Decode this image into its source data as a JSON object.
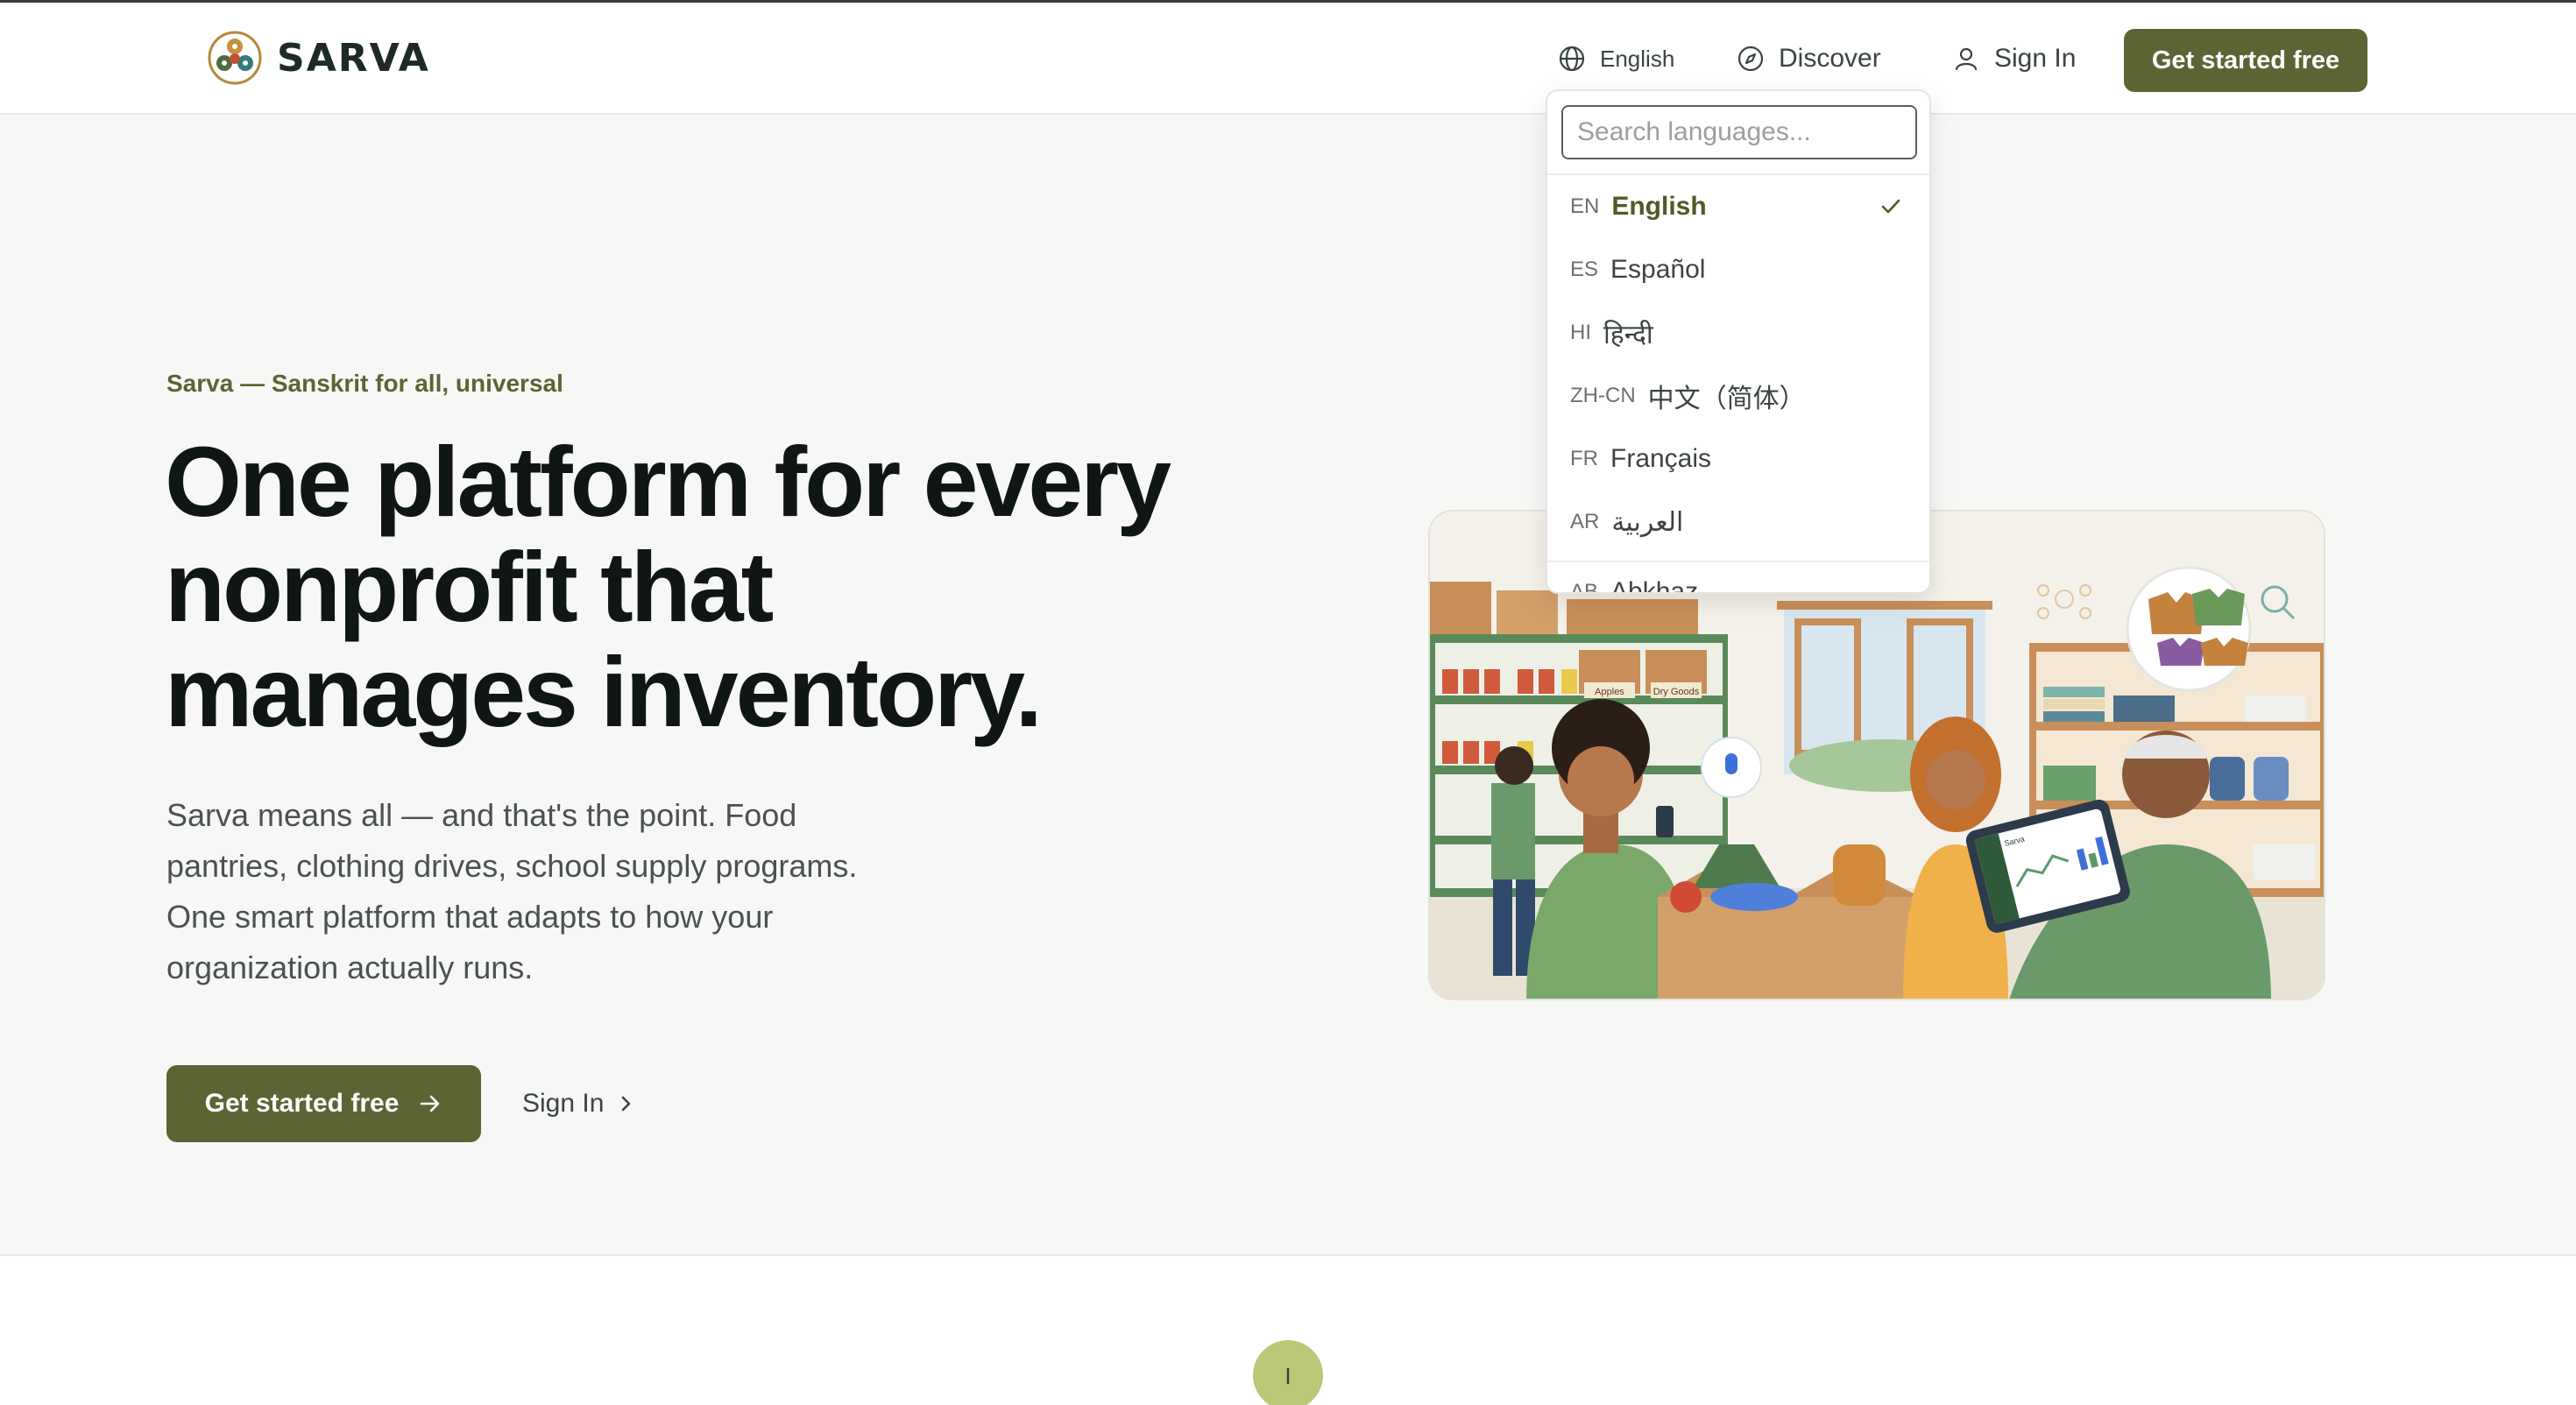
{
  "header": {
    "brand": "SARVA",
    "language_label": "English",
    "discover_label": "Discover",
    "signin_label": "Sign In",
    "cta_label": "Get started free"
  },
  "hero": {
    "eyebrow": "Sarva — Sanskrit for all, universal",
    "headline_line1": "One platform for every",
    "headline_line2": "nonprofit that",
    "headline_line3": "manages inventory.",
    "lede_line1": "Sarva means all — and that's the point. Food",
    "lede_line2": "pantries, clothing drives, school supply programs.",
    "lede_line3": "One smart platform that adapts to how your",
    "lede_line4": "organization actually runs.",
    "cta_label": "Get started free",
    "signin_label": "Sign In"
  },
  "illustration": {
    "sign_apples": "Apples",
    "sign_dry_goods": "Dry Goods",
    "tablet_title": "Sarva"
  },
  "language_dropdown": {
    "search_placeholder": "Search languages...",
    "items": [
      {
        "code": "EN",
        "label": "English",
        "selected": true
      },
      {
        "code": "ES",
        "label": "Español",
        "selected": false
      },
      {
        "code": "HI",
        "label": "हिन्दी",
        "selected": false
      },
      {
        "code": "ZH-CN",
        "label": "中文（简体）",
        "selected": false
      },
      {
        "code": "FR",
        "label": "Français",
        "selected": false
      },
      {
        "code": "AR",
        "label": "العربية",
        "selected": false
      },
      {
        "code": "AB",
        "label": "Abkhaz",
        "selected": false
      }
    ]
  },
  "bottom": {
    "badge_text": "I"
  },
  "colors": {
    "brand_olive": "#5c6434",
    "badge_green": "#bac878",
    "heading": "#101713"
  }
}
